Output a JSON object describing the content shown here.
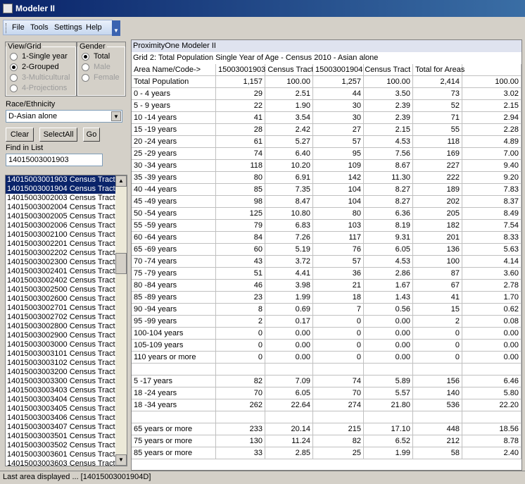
{
  "window": {
    "title": "Modeler II"
  },
  "menu": [
    "File",
    "Tools",
    "Settings",
    "Help"
  ],
  "viewgrid": {
    "legend": "View/Grid",
    "options": [
      {
        "label": "1-Single year",
        "checked": false,
        "disabled": false
      },
      {
        "label": "2-Grouped",
        "checked": true,
        "disabled": false
      },
      {
        "label": "3-Multicultural",
        "checked": false,
        "disabled": true
      },
      {
        "label": "4-Projections",
        "checked": false,
        "disabled": true
      }
    ]
  },
  "gender": {
    "legend": "Gender",
    "options": [
      {
        "label": "Total",
        "checked": true,
        "disabled": false
      },
      {
        "label": "Male",
        "checked": false,
        "disabled": true
      },
      {
        "label": "Female",
        "checked": false,
        "disabled": true
      }
    ]
  },
  "race": {
    "label": "Race/Ethnicity",
    "value": "D-Asian alone"
  },
  "buttons": {
    "clear": "Clear",
    "selectall": "SelectAll",
    "go": "Go"
  },
  "find": {
    "label": "Find in List",
    "value": "14015003001903"
  },
  "list": [
    {
      "text": "14015003001903 Census Tract",
      "selected": true
    },
    {
      "text": "14015003001904 Census Tract",
      "selected": true
    },
    {
      "text": "14015003002003 Census Tract",
      "selected": false
    },
    {
      "text": "14015003002004 Census Tract",
      "selected": false
    },
    {
      "text": "14015003002005 Census Tract",
      "selected": false
    },
    {
      "text": "14015003002006 Census Tract",
      "selected": false
    },
    {
      "text": "14015003002100 Census Tract",
      "selected": false
    },
    {
      "text": "14015003002201 Census Tract",
      "selected": false
    },
    {
      "text": "14015003002202 Census Tract",
      "selected": false
    },
    {
      "text": "14015003002300 Census Tract",
      "selected": false
    },
    {
      "text": "14015003002401 Census Tract",
      "selected": false
    },
    {
      "text": "14015003002402 Census Tract",
      "selected": false
    },
    {
      "text": "14015003002500 Census Tract",
      "selected": false
    },
    {
      "text": "14015003002600 Census Tract",
      "selected": false
    },
    {
      "text": "14015003002701 Census Tract",
      "selected": false
    },
    {
      "text": "14015003002702 Census Tract",
      "selected": false
    },
    {
      "text": "14015003002800 Census Tract",
      "selected": false
    },
    {
      "text": "14015003002900 Census Tract",
      "selected": false
    },
    {
      "text": "14015003003000 Census Tract",
      "selected": false
    },
    {
      "text": "14015003003101 Census Tract",
      "selected": false
    },
    {
      "text": "14015003003102 Census Tract",
      "selected": false
    },
    {
      "text": "14015003003200 Census Tract",
      "selected": false
    },
    {
      "text": "14015003003300 Census Tract",
      "selected": false
    },
    {
      "text": "14015003003403 Census Tract",
      "selected": false
    },
    {
      "text": "14015003003404 Census Tract",
      "selected": false
    },
    {
      "text": "14015003003405 Census Tract",
      "selected": false
    },
    {
      "text": "14015003003406 Census Tract",
      "selected": false
    },
    {
      "text": "14015003003407 Census Tract",
      "selected": false
    },
    {
      "text": "14015003003501 Census Tract",
      "selected": false
    },
    {
      "text": "14015003003502 Census Tract",
      "selected": false
    },
    {
      "text": "14015003003601 Census Tract",
      "selected": false
    },
    {
      "text": "14015003003603 Census Tract",
      "selected": false
    }
  ],
  "grid": {
    "app": "ProximityOne Modeler II",
    "title": "Grid 2: Total Population Single Year of Age - Census 2010 - Asian alone",
    "headers": [
      "Area Name/Code->",
      "15003001903 Census Tract",
      "",
      "15003001904 Census Tract",
      "",
      "Total for Areas",
      ""
    ],
    "rows": [
      [
        "Total Population",
        "1,157",
        "100.00",
        "1,257",
        "100.00",
        "2,414",
        "100.00"
      ],
      [
        "0 - 4 years",
        "29",
        "2.51",
        "44",
        "3.50",
        "73",
        "3.02"
      ],
      [
        "5 - 9 years",
        "22",
        "1.90",
        "30",
        "2.39",
        "52",
        "2.15"
      ],
      [
        "10 -14 years",
        "41",
        "3.54",
        "30",
        "2.39",
        "71",
        "2.94"
      ],
      [
        "15 -19 years",
        "28",
        "2.42",
        "27",
        "2.15",
        "55",
        "2.28"
      ],
      [
        "20 -24 years",
        "61",
        "5.27",
        "57",
        "4.53",
        "118",
        "4.89"
      ],
      [
        "25 -29 years",
        "74",
        "6.40",
        "95",
        "7.56",
        "169",
        "7.00"
      ],
      [
        "30 -34 years",
        "118",
        "10.20",
        "109",
        "8.67",
        "227",
        "9.40"
      ],
      [
        "35 -39 years",
        "80",
        "6.91",
        "142",
        "11.30",
        "222",
        "9.20"
      ],
      [
        "40 -44 years",
        "85",
        "7.35",
        "104",
        "8.27",
        "189",
        "7.83"
      ],
      [
        "45 -49 years",
        "98",
        "8.47",
        "104",
        "8.27",
        "202",
        "8.37"
      ],
      [
        "50 -54 years",
        "125",
        "10.80",
        "80",
        "6.36",
        "205",
        "8.49"
      ],
      [
        "55 -59 years",
        "79",
        "6.83",
        "103",
        "8.19",
        "182",
        "7.54"
      ],
      [
        "60 -64 years",
        "84",
        "7.26",
        "117",
        "9.31",
        "201",
        "8.33"
      ],
      [
        "65 -69 years",
        "60",
        "5.19",
        "76",
        "6.05",
        "136",
        "5.63"
      ],
      [
        "70 -74 years",
        "43",
        "3.72",
        "57",
        "4.53",
        "100",
        "4.14"
      ],
      [
        "75 -79 years",
        "51",
        "4.41",
        "36",
        "2.86",
        "87",
        "3.60"
      ],
      [
        "80 -84 years",
        "46",
        "3.98",
        "21",
        "1.67",
        "67",
        "2.78"
      ],
      [
        "85 -89 years",
        "23",
        "1.99",
        "18",
        "1.43",
        "41",
        "1.70"
      ],
      [
        "90 -94 years",
        "8",
        "0.69",
        "7",
        "0.56",
        "15",
        "0.62"
      ],
      [
        "95 -99 years",
        "2",
        "0.17",
        "0",
        "0.00",
        "2",
        "0.08"
      ],
      [
        "100-104 years",
        "0",
        "0.00",
        "0",
        "0.00",
        "0",
        "0.00"
      ],
      [
        "105-109 years",
        "0",
        "0.00",
        "0",
        "0.00",
        "0",
        "0.00"
      ],
      [
        "110 years or more",
        "0",
        "0.00",
        "0",
        "0.00",
        "0",
        "0.00"
      ],
      [
        "",
        "",
        "",
        "",
        "",
        "",
        ""
      ],
      [
        "5 -17 years",
        "82",
        "7.09",
        "74",
        "5.89",
        "156",
        "6.46"
      ],
      [
        "18 -24 years",
        "70",
        "6.05",
        "70",
        "5.57",
        "140",
        "5.80"
      ],
      [
        "18 -34 years",
        "262",
        "22.64",
        "274",
        "21.80",
        "536",
        "22.20"
      ],
      [
        "",
        "",
        "",
        "",
        "",
        "",
        ""
      ],
      [
        "65 years or more",
        "233",
        "20.14",
        "215",
        "17.10",
        "448",
        "18.56"
      ],
      [
        "75 years or more",
        "130",
        "11.24",
        "82",
        "6.52",
        "212",
        "8.78"
      ],
      [
        "85 years or more",
        "33",
        "2.85",
        "25",
        "1.99",
        "58",
        "2.40"
      ]
    ]
  },
  "status": "Last area displayed ... [14015003001904D]"
}
